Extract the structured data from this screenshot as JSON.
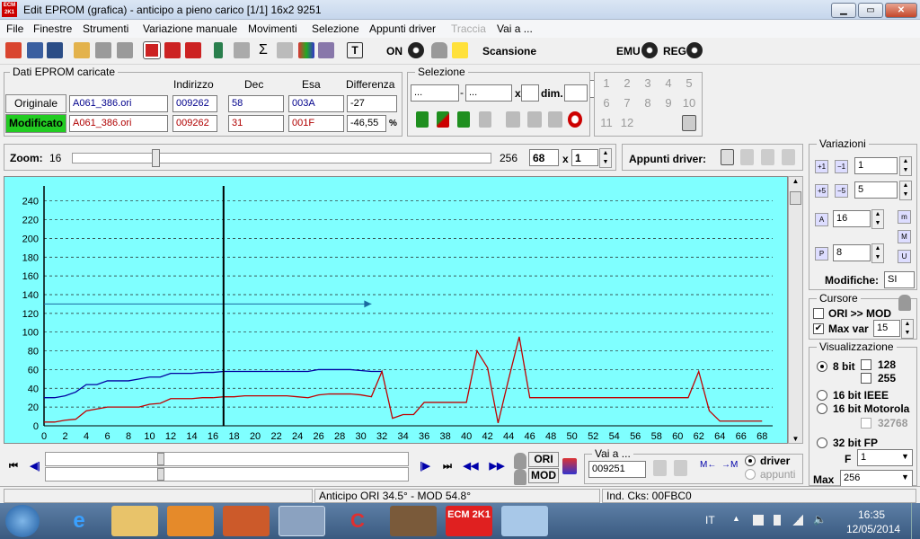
{
  "window": {
    "title": "Edit EPROM (grafica) - anticipo a pieno carico  [1/1] 16x2  9251",
    "logo_text": "ECM 2K1",
    "minimize": "▁",
    "maximize": "▭",
    "close": "✕"
  },
  "menu": [
    "File",
    "Finestre",
    "Strumenti",
    "Variazione manuale",
    "Movimenti",
    "Selezione",
    "Appunti driver",
    "Traccia",
    "Vai a ..."
  ],
  "toolbar": {
    "on_label": "ON",
    "scansione_label": "Scansione",
    "emu_label": "EMU",
    "reg_label": "REG"
  },
  "eprom": {
    "legend": "Dati EPROM caricate",
    "headers": {
      "indirizzo": "Indirizzo",
      "dec": "Dec",
      "esa": "Esa",
      "differenza": "Differenza"
    },
    "originale": {
      "label": "Originale",
      "file": "A061_386.ori",
      "indirizzo": "009262",
      "dec": "58",
      "esa": "003A",
      "diff": "-27"
    },
    "modificato": {
      "label": "Modificato",
      "file": "A061_386.ori",
      "indirizzo": "009262",
      "dec": "31",
      "esa": "001F",
      "diff": "-46,55",
      "unit": "%"
    }
  },
  "selezione": {
    "legend": "Selezione",
    "from": "...",
    "to": "...",
    "x_label": "x",
    "dim_label": "dim."
  },
  "numpad": [
    "1",
    "2",
    "3",
    "4",
    "5",
    "6",
    "7",
    "8",
    "9",
    "10",
    "11",
    "12"
  ],
  "zoom": {
    "label": "Zoom:",
    "min": "16",
    "max": "256",
    "value": "68",
    "x_label": "x",
    "multiplier": "1",
    "level": 0.2
  },
  "appunti": {
    "label": "Appunti driver:"
  },
  "variazioni": {
    "legend": "Variazioni",
    "v1": "1",
    "v5": "5",
    "va": "16",
    "vp": "8",
    "modifiche_label": "Modifiche:",
    "modifiche_value": "SI"
  },
  "cursore": {
    "legend": "Cursore",
    "ori_mod_label": "ORI >> MOD",
    "ori_mod_checked": false,
    "maxvar_label": "Max var",
    "maxvar_checked": true,
    "maxvar_value": "15"
  },
  "visualizzazione": {
    "legend": "Visualizzazione",
    "opt_8bit": "8 bit",
    "opt_128": "128",
    "opt_255": "255",
    "opt_16ieee": "16 bit IEEE",
    "opt_16moto": "16 bit Motorola",
    "opt_32768": "32768",
    "opt_32fp": "32 bit FP",
    "f_label": "F",
    "f_value": "1",
    "max_label": "Max",
    "max_value": "256"
  },
  "nav": {
    "ori_label": "ORI",
    "mod_label": "MOD"
  },
  "vaia": {
    "legend": "Vai a ...",
    "value": "009251",
    "driver_label": "driver",
    "appunti_label": "appunti"
  },
  "status": {
    "anticipo": "Anticipo ORI 34.5°  - MOD 54.8°",
    "cks": "Ind. Cks: 00FBC0"
  },
  "taskbar": {
    "lang": "IT",
    "time": "16:35",
    "date": "12/05/2014"
  },
  "chart_data": {
    "type": "line",
    "x_ticks": [
      0,
      2,
      4,
      6,
      8,
      10,
      12,
      14,
      16,
      18,
      20,
      22,
      24,
      26,
      28,
      30,
      32,
      34,
      36,
      38,
      40,
      42,
      44,
      46,
      48,
      50,
      52,
      54,
      56,
      58,
      60,
      62,
      64,
      66,
      68
    ],
    "y_ticks": [
      0,
      20,
      40,
      60,
      80,
      100,
      120,
      140,
      160,
      180,
      200,
      220,
      240
    ],
    "xlim": [
      0,
      69
    ],
    "ylim": [
      0,
      256
    ],
    "cursor_x": 17,
    "arrow": {
      "x1": 0,
      "x2": 31,
      "y": 130
    },
    "grid": "horizontal dashed",
    "series": [
      {
        "color": "#0000a0",
        "x": [
          0,
          1,
          2,
          3,
          4,
          5,
          6,
          7,
          8,
          9,
          10,
          11,
          12,
          13,
          14,
          15,
          16,
          17,
          18,
          19,
          20,
          21,
          22,
          23,
          24,
          25,
          26,
          27,
          28,
          29,
          30,
          31,
          32
        ],
        "values": [
          30,
          30,
          32,
          36,
          44,
          44,
          48,
          48,
          48,
          50,
          52,
          52,
          56,
          56,
          56,
          57,
          57,
          58,
          58,
          58,
          58,
          58,
          58,
          58,
          58,
          58,
          60,
          60,
          60,
          60,
          59,
          58,
          58
        ]
      },
      {
        "color": "#c00000",
        "x": [
          0,
          1,
          2,
          3,
          4,
          5,
          6,
          7,
          8,
          9,
          10,
          11,
          12,
          13,
          14,
          15,
          16,
          17,
          18,
          19,
          20,
          21,
          22,
          23,
          24,
          25,
          26,
          27,
          28,
          29,
          30,
          31,
          32,
          33,
          34,
          35,
          36,
          37,
          38,
          39,
          40,
          41,
          42,
          43,
          44,
          45,
          46,
          47,
          48,
          49,
          50,
          51,
          52,
          53,
          54,
          55,
          56,
          57,
          58,
          59,
          60,
          61,
          62,
          63,
          64,
          65,
          66,
          67,
          68
        ],
        "values": [
          4,
          4,
          6,
          7,
          16,
          18,
          20,
          20,
          20,
          20,
          23,
          24,
          29,
          29,
          29,
          30,
          30,
          31,
          31,
          32,
          32,
          32,
          32,
          32,
          31,
          30,
          33,
          34,
          34,
          34,
          33,
          31,
          58,
          8,
          12,
          12,
          25,
          25,
          25,
          25,
          25,
          80,
          62,
          3,
          50,
          95,
          30,
          30,
          30,
          30,
          30,
          30,
          30,
          30,
          30,
          30,
          30,
          30,
          30,
          30,
          30,
          30,
          58,
          16,
          5,
          5,
          5,
          5,
          5
        ]
      }
    ]
  }
}
